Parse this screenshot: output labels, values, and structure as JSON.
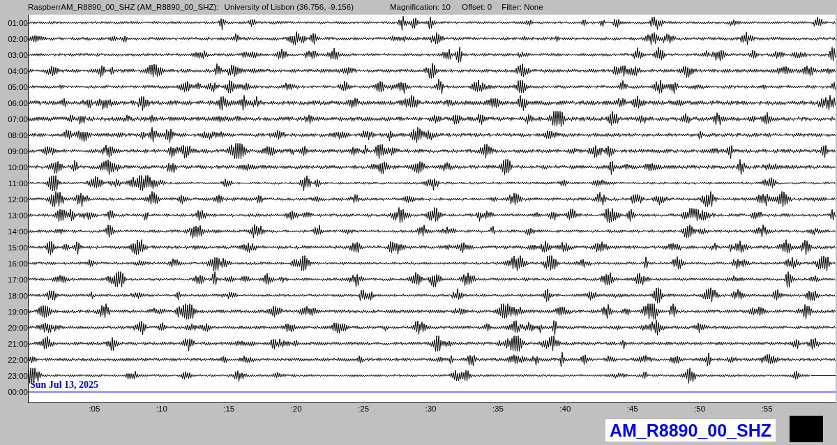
{
  "header": {
    "station": "RaspberrAM_R8890_00_SHZ (AM_R8890_00_SHZ):",
    "location": "University of Lisbon (36.756, -9.156)",
    "magnification": "Magnification: 10",
    "offset": "Offset: 0",
    "filter": "Filter: None"
  },
  "rows": [
    {
      "label": "01:00",
      "kind": "trace"
    },
    {
      "label": "02:00",
      "kind": "trace"
    },
    {
      "label": "03:00",
      "kind": "trace"
    },
    {
      "label": "04:00",
      "kind": "trace"
    },
    {
      "label": "05:00",
      "kind": "trace"
    },
    {
      "label": "06:00",
      "kind": "trace"
    },
    {
      "label": "07:00",
      "kind": "trace"
    },
    {
      "label": "08:00",
      "kind": "trace"
    },
    {
      "label": "09:00",
      "kind": "trace"
    },
    {
      "label": "10:00",
      "kind": "trace"
    },
    {
      "label": "11:00",
      "kind": "trace"
    },
    {
      "label": "12:00",
      "kind": "trace"
    },
    {
      "label": "13:00",
      "kind": "trace"
    },
    {
      "label": "14:00",
      "kind": "trace"
    },
    {
      "label": "15:00",
      "kind": "trace"
    },
    {
      "label": "16:00",
      "kind": "trace"
    },
    {
      "label": "17:00",
      "kind": "trace"
    },
    {
      "label": "18:00",
      "kind": "trace"
    },
    {
      "label": "19:00",
      "kind": "trace"
    },
    {
      "label": "20:00",
      "kind": "trace"
    },
    {
      "label": "21:00",
      "kind": "trace"
    },
    {
      "label": "22:00",
      "kind": "trace"
    },
    {
      "label": "23:00",
      "kind": "partial"
    },
    {
      "label": "00:00",
      "kind": "empty"
    }
  ],
  "date": "Sun Jul 13, 2025",
  "x_ticks": [
    ":05",
    ":10",
    ":15",
    ":20",
    ":25",
    ":30",
    ":35",
    ":40",
    ":45",
    ":50",
    ":55"
  ],
  "footer": {
    "channel": "AM_R8890_00_SHZ"
  }
}
